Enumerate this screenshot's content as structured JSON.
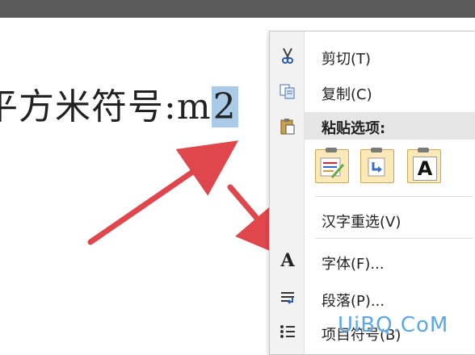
{
  "document": {
    "lead_text": "平方米符号:",
    "m": "m",
    "selected": "2"
  },
  "menu": {
    "cut": {
      "icon": "scissors-icon",
      "label": "剪切(T)"
    },
    "copy": {
      "icon": "copy-icon",
      "label": "复制(C)"
    },
    "paste_options": {
      "icon": "paste-icon",
      "label": "粘贴选项:"
    },
    "paste_buttons": [
      {
        "name": "keep-source-formatting"
      },
      {
        "name": "merge-formatting"
      },
      {
        "name": "keep-text-only",
        "glyph": "A"
      }
    ],
    "reconvert": {
      "label": "汉字重选(V)"
    },
    "font": {
      "icon": "font-icon",
      "glyph": "A",
      "label": "字体(F)..."
    },
    "paragraph": {
      "icon": "paragraph-icon",
      "label": "段落(P)..."
    },
    "bullets": {
      "icon": "bullets-icon",
      "label": "项目符号(B)"
    }
  },
  "watermark": "UiBQ.CoM",
  "colors": {
    "selection": "#a9cbe8",
    "arrow": "#e0474c",
    "watermark": "#5aa8e8"
  }
}
